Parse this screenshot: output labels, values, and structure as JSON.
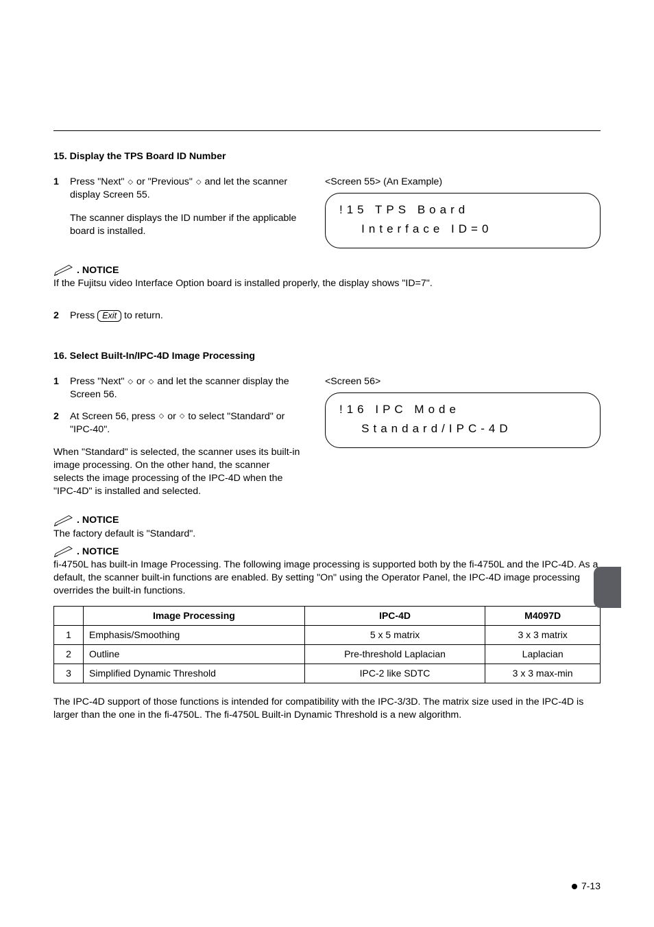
{
  "sec15": {
    "title": "15. Display the TPS Board ID Number",
    "step1_a": "Press \"Next\" ",
    "step1_b": " or \"Previous\" ",
    "step1_c": " and let the scanner display Screen 55.",
    "step1_para2": "The scanner displays the ID number if the applicable board is installed.",
    "screen_label": "<Screen 55> (An Example)",
    "lcd_line1": "!15 TPS Board",
    "lcd_line2": "   Interface ID=0",
    "notice_label": "NOTICE",
    "notice_text": "If the Fujitsu video Interface Option board is installed properly, the display shows \"ID=7\".",
    "step2_a": "Press ",
    "exit_label": "Exit",
    "step2_b": " to return."
  },
  "sec16": {
    "title": "16. Select Built-In/IPC-4D Image Processing",
    "step1_a": "Press \"Next\" ",
    "step1_b": " or ",
    "step1_c": " and let the scanner display the Screen 56.",
    "step2_a": "At Screen 56, press ",
    "step2_b": " or ",
    "step2_c": " to select \"Standard\" or \"IPC-40\".",
    "para": "When \"Standard\" is selected, the scanner uses its built-in image processing.  On the other hand, the scanner selects the image processing of the IPC-4D when the \"IPC-4D\" is installed and selected.",
    "screen_label": "<Screen 56>",
    "lcd_line1": "!16 IPC Mode",
    "lcd_line2": "   Standard/IPC-4D",
    "notice1_label": "NOTICE",
    "notice1_text": "The factory default is \"Standard\".",
    "notice2_label": "NOTICE",
    "notice2_text": "fi-4750L has built-in Image Processing.  The following image processing is supported both by the fi-4750L and the IPC-4D.  As a default, the scanner built-in functions are enabled.  By setting \"On\" using the Operator Panel, the IPC-4D image processing overrides the built-in functions."
  },
  "table": {
    "headers": [
      "",
      "Image Processing",
      "IPC-4D",
      "M4097D"
    ],
    "rows": [
      [
        "1",
        "Emphasis/Smoothing",
        "5 x 5 matrix",
        "3 x 3 matrix"
      ],
      [
        "2",
        "Outline",
        "Pre-threshold Laplacian",
        "Laplacian"
      ],
      [
        "3",
        "Simplified Dynamic Threshold",
        "IPC-2 like SDTC",
        "3 x 3 max-min"
      ]
    ]
  },
  "closing": "The IPC-4D support of those functions is intended for compatibility with the IPC-3/3D.  The matrix size used in the IPC-4D is larger than the one in the fi-4750L. The fi-4750L Built-in Dynamic Threshold is a new algorithm.",
  "footer": "7-13",
  "steps": {
    "n1": "1",
    "n2": "2"
  }
}
